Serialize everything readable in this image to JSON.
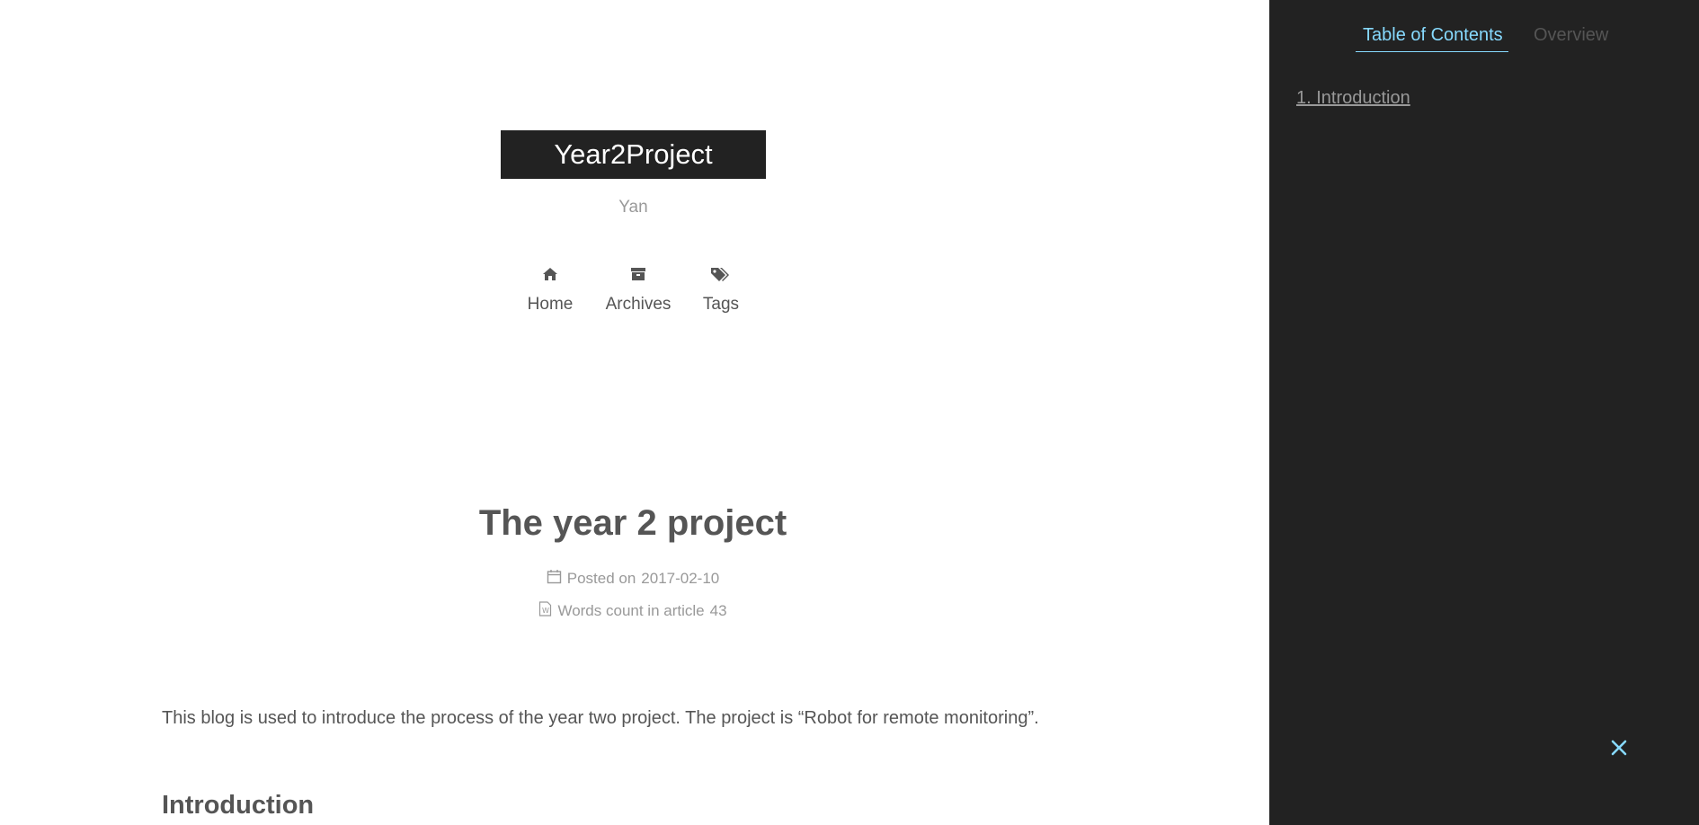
{
  "site": {
    "title": "Year2Project",
    "subtitle": "Yan"
  },
  "nav": {
    "items": [
      {
        "label": "Home",
        "icon": "home-icon"
      },
      {
        "label": "Archives",
        "icon": "archive-icon"
      },
      {
        "label": "Tags",
        "icon": "tags-icon"
      }
    ]
  },
  "post": {
    "title": "The year 2 project",
    "posted_label": "Posted on",
    "posted_date": "2017-02-10",
    "words_label": "Words count in article",
    "words_count": "43",
    "intro_text": "This blog is used to introduce the process of the year two project. The project is “Robot for remote monitoring”.",
    "section_heading": "Introduction"
  },
  "sidebar": {
    "tabs": [
      {
        "label": "Table of Contents",
        "active": true
      },
      {
        "label": "Overview",
        "active": false
      }
    ],
    "toc": [
      {
        "label": "1. Introduction"
      }
    ],
    "accent_color": "#87daff",
    "background_color": "#222222"
  }
}
